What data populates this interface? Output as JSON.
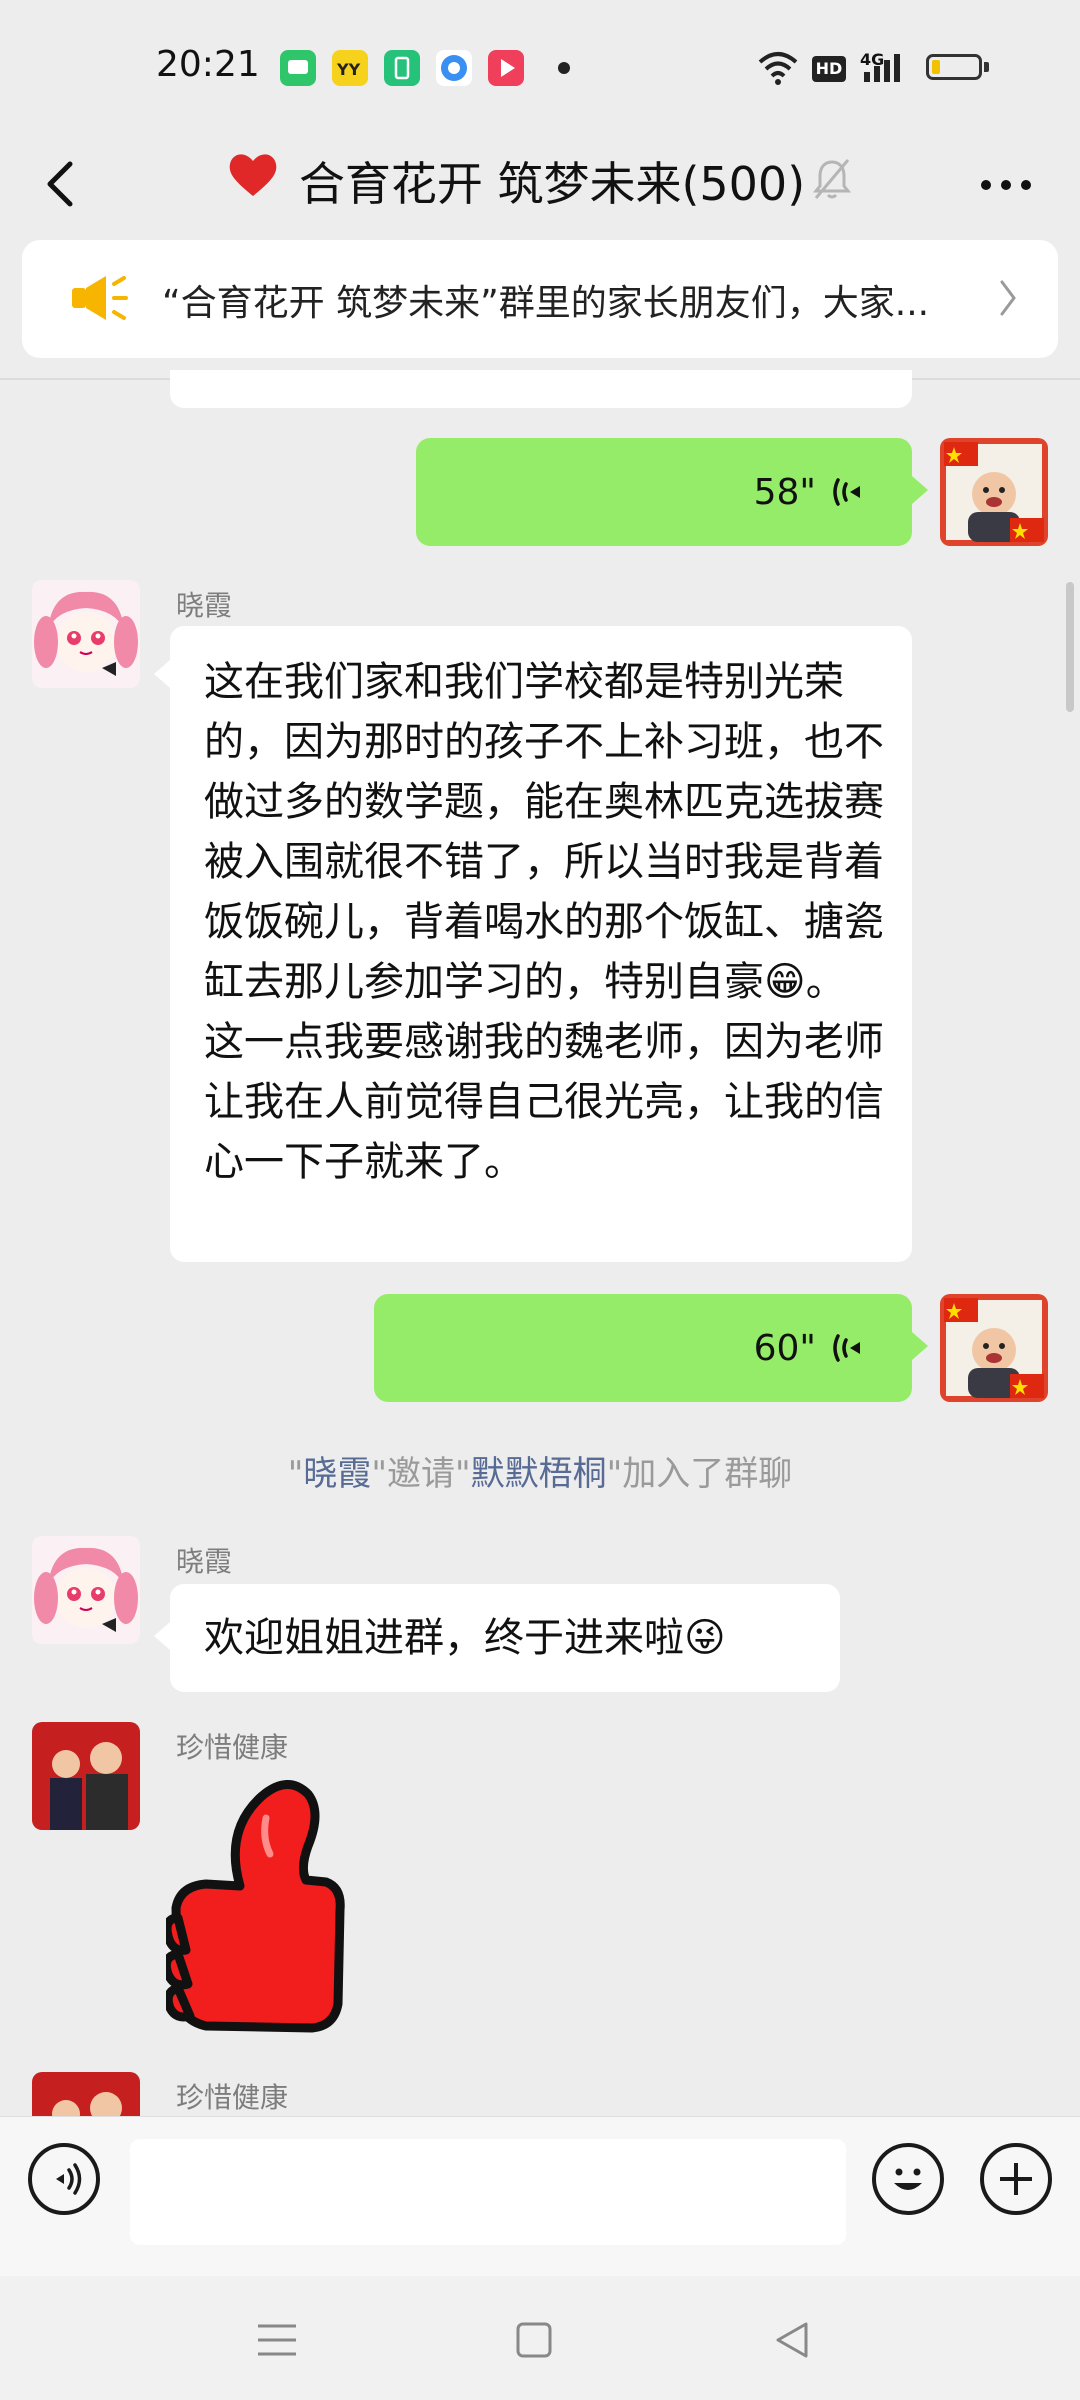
{
  "status_bar": {
    "time": "20:21",
    "network": "4G",
    "hd_label": "HD",
    "battery_level": 0.15
  },
  "header": {
    "title": "合育花开 筑梦未来(500)"
  },
  "notice": {
    "text": "“合育花开 筑梦未来”群里的家长朋友们，大家..."
  },
  "messages": [
    {
      "type": "voice",
      "direction": "out",
      "duration": "58\""
    },
    {
      "type": "text",
      "direction": "in",
      "sender": "晓霞",
      "text": "这在我们家和我们学校都是特别光荣的，因为那时的孩子不上补习班，也不做过多的数学题，能在奥林匹克选拔赛被入围就很不错了，所以当时我是背着饭饭碗儿，背着喝水的那个饭缸、搪瓷缸去那儿参加学习的，特别自豪😁。这一点我要感谢我的魏老师，因为老师让我在人前觉得自己很光亮，让我的信心一下子就来了。"
    },
    {
      "type": "voice",
      "direction": "out",
      "duration": "60\""
    },
    {
      "type": "system",
      "inviter": "晓霞",
      "invitee": "默默梧桐",
      "q1": "\"",
      "q2": "\"邀请\"",
      "q3": "\"加入了群聊"
    },
    {
      "type": "text",
      "direction": "in",
      "sender": "晓霞",
      "text": "欢迎姐姐进群，终于进来啦😜"
    },
    {
      "type": "sticker",
      "direction": "in",
      "sender": "珍惜健康",
      "sticker": "thumbs-up"
    },
    {
      "type": "partial",
      "direction": "in",
      "sender": "珍惜健康"
    }
  ],
  "colors": {
    "bubble_out": "#95ec69",
    "bubble_in": "#ffffff",
    "link": "#576b95",
    "background": "#ededed"
  }
}
